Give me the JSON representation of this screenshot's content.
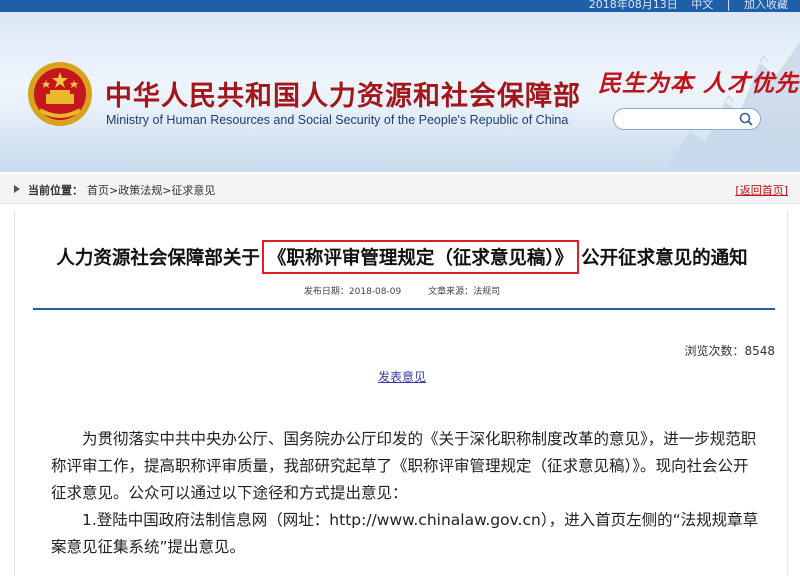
{
  "header": {
    "top_links": [
      "2018年08月13日",
      "中文",
      "|",
      "加入收藏"
    ],
    "title": "中华人民共和国人力资源和社会保障部",
    "subtitle": "Ministry of Human Resources and Social Security of the People's Republic of China",
    "slogan": "民生为本 人才优先",
    "search_placeholder": ""
  },
  "breadcrumb": {
    "label": "当前位置：",
    "items": [
      "首页",
      ">",
      "政策法规",
      ">",
      "征求意见"
    ],
    "back": "[返回首页]"
  },
  "article": {
    "title_prefix": "人力资源社会保障部关于",
    "title_highlight": "《职称评审管理规定（征求意见稿）》",
    "title_suffix": "公开征求意见的通知",
    "publish_date": "发布日期：2018-08-09",
    "source": "文章来源：法规司",
    "views": "浏览次数：8548",
    "comment_link": "发表意见",
    "paragraph1": "为贯彻落实中共中央办公厅、国务院办公厅印发的《关于深化职称制度改革的意见》，进一步规范职称评审工作，提高职称评审质量，我部研究起草了《职称评审管理规定（征求意见稿）》。现向社会公开征求意见。公众可以通过以下途径和方式提出意见：",
    "paragraph2": "1.登陆中国政府法制信息网（网址：http://www.chinalaw.gov.cn），进入首页左侧的“法规规章草案意见征集系统”提出意见。"
  },
  "colors": {
    "brand_blue": "#1f5ea8",
    "title_red": "#a3161a",
    "highlight_red": "#e21e22"
  }
}
